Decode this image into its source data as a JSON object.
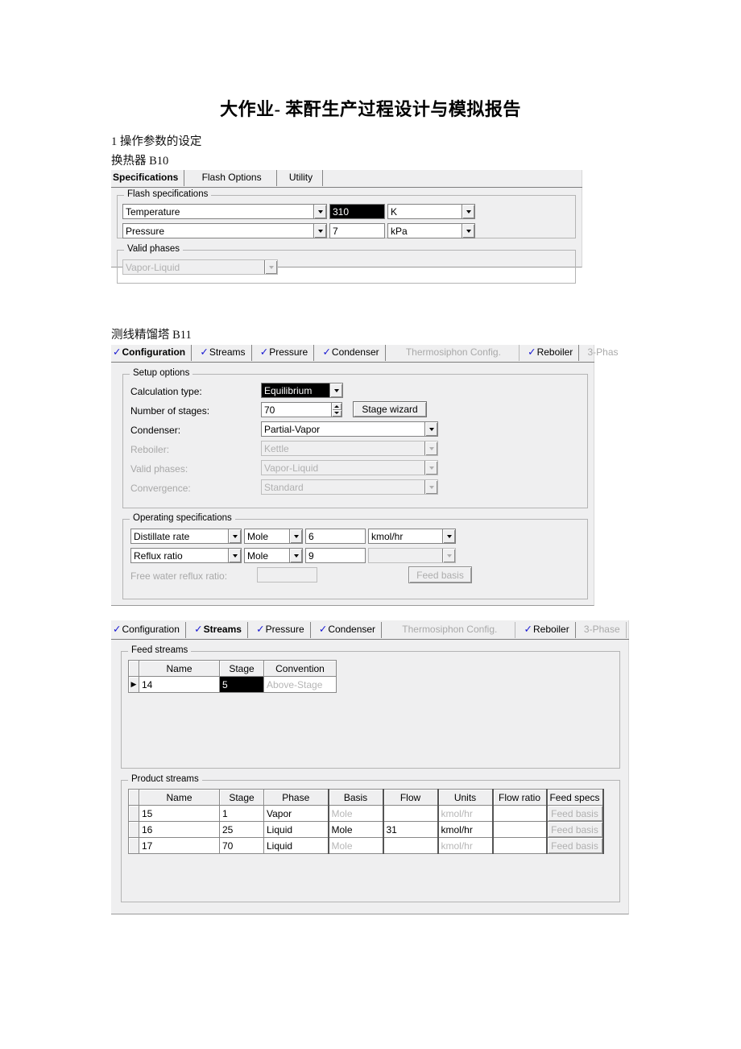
{
  "document": {
    "title": "大作业- 苯酐生产过程设计与模拟报告",
    "section_heading": "1 操作参数的设定",
    "label_b10": "换热器 B10",
    "label_b11": "测线精馏塔 B11"
  },
  "heater_dialog": {
    "tabs": [
      {
        "label": "Specifications",
        "selected": true,
        "disabled": false
      },
      {
        "label": "Flash Options",
        "selected": false,
        "disabled": false
      },
      {
        "label": "Utility",
        "selected": false,
        "disabled": false
      }
    ],
    "flash_specifications": {
      "group_label": "Flash specifications",
      "rows": [
        {
          "spec": "Temperature",
          "value": "310",
          "value_selected": true,
          "units": "K",
          "units_disabled": false
        },
        {
          "spec": "Pressure",
          "value": "7",
          "value_selected": false,
          "units": "kPa",
          "units_disabled": false
        }
      ]
    },
    "valid_phases": {
      "group_label": "Valid phases",
      "value": "Vapor-Liquid",
      "disabled": true
    }
  },
  "column_config_dialog": {
    "tabs": [
      {
        "label": "Configuration",
        "check": true,
        "selected": true,
        "disabled": false
      },
      {
        "label": "Streams",
        "check": true,
        "selected": false,
        "disabled": false
      },
      {
        "label": "Pressure",
        "check": true,
        "selected": false,
        "disabled": false
      },
      {
        "label": "Condenser",
        "check": true,
        "selected": false,
        "disabled": false
      },
      {
        "label": "Thermosiphon Config.",
        "check": false,
        "selected": false,
        "disabled": true
      },
      {
        "label": "Reboiler",
        "check": true,
        "selected": false,
        "disabled": false
      },
      {
        "label": "3-Phas",
        "check": false,
        "selected": false,
        "disabled": true
      }
    ],
    "setup_options": {
      "group_label": "Setup options",
      "calculation_type": {
        "label": "Calculation type:",
        "value": "Equilibrium",
        "selected": true,
        "disabled": false
      },
      "number_of_stages": {
        "label": "Number of stages:",
        "value": "70",
        "disabled": false
      },
      "stage_wizard_button": "Stage wizard",
      "condenser": {
        "label": "Condenser:",
        "value": "Partial-Vapor",
        "disabled": false
      },
      "reboiler": {
        "label": "Reboiler:",
        "value": "Kettle",
        "disabled": true
      },
      "valid_phases": {
        "label": "Valid phases:",
        "value": "Vapor-Liquid",
        "disabled": true
      },
      "convergence": {
        "label": "Convergence:",
        "value": "Standard",
        "disabled": true
      }
    },
    "operating_specifications": {
      "group_label": "Operating specifications",
      "rows": [
        {
          "spec": "Distillate rate",
          "basis": "Mole",
          "value": "6",
          "units": "kmol/hr",
          "units_disabled": false
        },
        {
          "spec": "Reflux ratio",
          "basis": "Mole",
          "value": "9",
          "units": "",
          "units_disabled": true
        }
      ],
      "free_water_label": "Free water reflux ratio:",
      "free_water_value": "",
      "feed_basis_button": "Feed basis"
    }
  },
  "column_streams_dialog": {
    "tabs": [
      {
        "label": "Configuration",
        "check": true,
        "selected": false,
        "disabled": false
      },
      {
        "label": "Streams",
        "check": true,
        "selected": true,
        "disabled": false
      },
      {
        "label": "Pressure",
        "check": true,
        "selected": false,
        "disabled": false
      },
      {
        "label": "Condenser",
        "check": true,
        "selected": false,
        "disabled": false
      },
      {
        "label": "Thermosiphon Config.",
        "check": false,
        "selected": false,
        "disabled": true
      },
      {
        "label": "Reboiler",
        "check": true,
        "selected": false,
        "disabled": false
      },
      {
        "label": "3-Phase",
        "check": false,
        "selected": false,
        "disabled": true
      }
    ],
    "feed_streams": {
      "group_label": "Feed streams",
      "columns": [
        "Name",
        "Stage",
        "Convention"
      ],
      "rows": [
        {
          "marker": "▶",
          "name": "14",
          "stage": "5",
          "stage_selected": true,
          "convention": "Above-Stage",
          "convention_disabled": true
        }
      ]
    },
    "product_streams": {
      "group_label": "Product streams",
      "columns": [
        "Name",
        "Stage",
        "Phase",
        "Basis",
        "Flow",
        "Units",
        "Flow ratio",
        "Feed specs"
      ],
      "rows": [
        {
          "name": "15",
          "stage": "1",
          "phase": "Vapor",
          "basis": "Mole",
          "basis_disabled": true,
          "flow": "",
          "units": "kmol/hr",
          "units_disabled": true,
          "flow_ratio": "",
          "feed_specs": "Feed basis"
        },
        {
          "name": "16",
          "stage": "25",
          "phase": "Liquid",
          "basis": "Mole",
          "basis_disabled": false,
          "flow": "31",
          "units": "kmol/hr",
          "units_disabled": false,
          "flow_ratio": "",
          "feed_specs": "Feed basis"
        },
        {
          "name": "17",
          "stage": "70",
          "phase": "Liquid",
          "basis": "Mole",
          "basis_disabled": true,
          "flow": "",
          "units": "kmol/hr",
          "units_disabled": true,
          "flow_ratio": "",
          "feed_specs": "Feed basis"
        }
      ]
    }
  }
}
